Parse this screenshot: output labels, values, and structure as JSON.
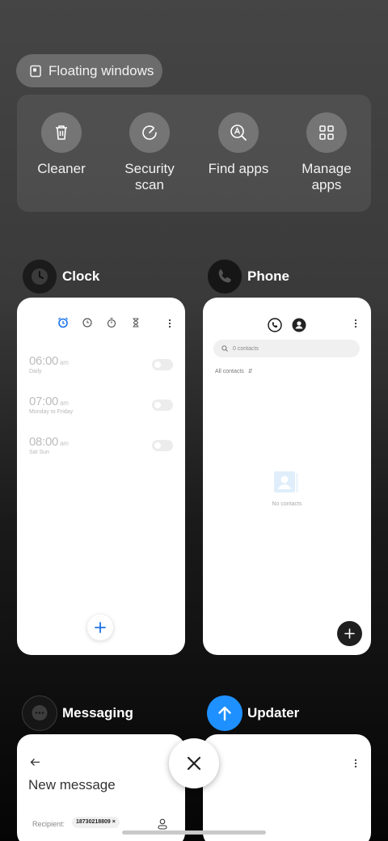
{
  "floating_windows": {
    "label": "Floating windows",
    "icon": "floating-window-icon"
  },
  "tools": [
    {
      "label": "Cleaner",
      "icon": "trash-icon"
    },
    {
      "label": "Security scan",
      "icon": "security-scan-icon"
    },
    {
      "label": "Find apps",
      "icon": "find-apps-icon"
    },
    {
      "label": "Manage apps",
      "icon": "grid-icon"
    }
  ],
  "apps": {
    "clock": {
      "name": "Clock",
      "icon": "clock-app-icon",
      "alarms": [
        {
          "time": "06:00",
          "ampm": "am",
          "repeat": "Daily"
        },
        {
          "time": "07:00",
          "ampm": "am",
          "repeat": "Monday to Friday"
        },
        {
          "time": "08:00",
          "ampm": "am",
          "repeat": "Sat Sun"
        }
      ],
      "accent": "#1a73e8"
    },
    "phone": {
      "name": "Phone",
      "icon": "phone-app-icon",
      "search_placeholder": "0 contacts",
      "filter_label": "All contacts",
      "empty_text": "No contacts"
    },
    "messaging": {
      "name": "Messaging",
      "icon": "messaging-app-icon",
      "title": "New message",
      "recipient_label": "Recipient:",
      "recipient_chip": "18730218809 ×"
    },
    "updater": {
      "name": "Updater",
      "icon": "updater-app-icon",
      "accent": "#1e90ff"
    }
  }
}
